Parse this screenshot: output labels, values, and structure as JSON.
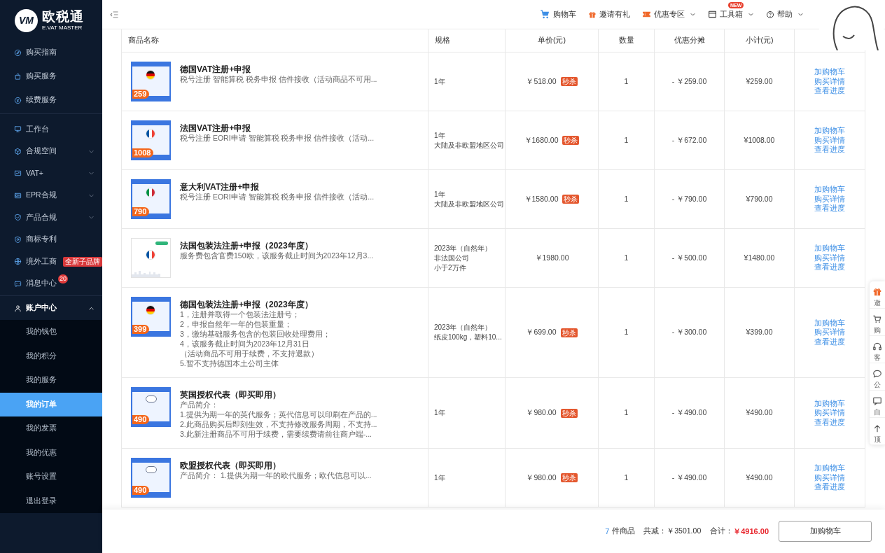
{
  "logo": {
    "mark": "VM",
    "name": "欧税通",
    "tagline": "E.VAT MASTER"
  },
  "sidebar": {
    "sections": [
      {
        "items": [
          {
            "label": "购买指南",
            "selected": false
          },
          {
            "label": "购买服务",
            "selected": false
          },
          {
            "label": "续费服务",
            "selected": false
          }
        ]
      },
      {
        "items": [
          {
            "label": "工作台",
            "selected": false
          },
          {
            "label": "合规空间",
            "selected": false,
            "expanded": false
          },
          {
            "label": "VAT+",
            "selected": false,
            "expanded": false
          },
          {
            "label": "EPR合规",
            "selected": false,
            "expanded": false
          },
          {
            "label": "产品合规",
            "selected": false,
            "expanded": false
          },
          {
            "label": "商标专利",
            "selected": false
          },
          {
            "label": "境外工商",
            "selected": false,
            "badge": "全新子品牌"
          },
          {
            "label": "消息中心",
            "selected": false,
            "count": "20"
          }
        ]
      },
      {
        "items": [
          {
            "label": "账户中心",
            "selected": false,
            "expanded": true,
            "children": [
              {
                "label": "我的钱包",
                "selected": false
              },
              {
                "label": "我的积分",
                "selected": false
              },
              {
                "label": "我的服务",
                "selected": false
              },
              {
                "label": "我的订单",
                "selected": true
              },
              {
                "label": "我的发票",
                "selected": false
              },
              {
                "label": "我的优惠",
                "selected": false
              },
              {
                "label": "账号设置",
                "selected": false
              },
              {
                "label": "退出登录",
                "selected": false
              }
            ]
          }
        ]
      }
    ]
  },
  "topbar": {
    "links": [
      {
        "label": "购物车",
        "dropdown": false
      },
      {
        "label": "邀请有礼",
        "dropdown": false
      },
      {
        "label": "优惠专区",
        "dropdown": true
      },
      {
        "label": "工具箱",
        "dropdown": true,
        "badge": "NEW"
      },
      {
        "label": "帮助",
        "dropdown": true
      }
    ]
  },
  "table": {
    "columns": [
      "商品名称",
      "规格",
      "单价(元)",
      "数量",
      "优惠分摊",
      "小计(元)"
    ],
    "rows": [
      {
        "image": {
          "kind": "germany",
          "price": "259"
        },
        "title": "德国VAT注册+申报",
        "description": [
          "税号注册 智能算税 税务申报 信件接收（活动商品不可用..."
        ],
        "spec": [
          "1年"
        ],
        "unit_price": "￥518.00",
        "flash_sale": "秒杀",
        "quantity": "1",
        "discount": "- ￥259.00",
        "subtotal": "¥259.00",
        "actions": [
          "加购物车",
          "购买详情",
          "查看进度"
        ]
      },
      {
        "image": {
          "kind": "france",
          "price": "1008"
        },
        "title": "法国VAT注册+申报",
        "description": [
          "税号注册 EORI申请 智能算税 税务申报 信件接收（活动..."
        ],
        "spec": [
          "1年",
          "大陆及非欧盟地区公司"
        ],
        "unit_price": "￥1680.00",
        "flash_sale": "秒杀",
        "quantity": "1",
        "discount": "- ￥672.00",
        "subtotal": "¥1008.00",
        "actions": [
          "加购物车",
          "购买详情",
          "查看进度"
        ]
      },
      {
        "image": {
          "kind": "italy",
          "price": "790"
        },
        "title": "意大利VAT注册+申报",
        "description": [
          "税号注册 EORI申请 智能算税 税务申报 信件接收（活动..."
        ],
        "spec": [
          "1年",
          "大陆及非欧盟地区公司"
        ],
        "unit_price": "￥1580.00",
        "flash_sale": "秒杀",
        "quantity": "1",
        "discount": "- ￥790.00",
        "subtotal": "¥790.00",
        "actions": [
          "加购物车",
          "购买详情",
          "查看进度"
        ]
      },
      {
        "image": {
          "kind": "packaging"
        },
        "title": "法国包装法注册+申报（2023年度）",
        "description": [
          "服务费包含官费150欧，该服务截止时间为2023年12月3..."
        ],
        "spec": [
          "2023年（自然年）",
          "非法国公司",
          "小于2万件"
        ],
        "unit_price": "￥1980.00",
        "quantity": "1",
        "discount": "- ￥500.00",
        "subtotal": "¥1480.00",
        "actions": [
          "加购物车",
          "购买详情",
          "查看进度"
        ]
      },
      {
        "image": {
          "kind": "germany",
          "price": "399"
        },
        "title": "德国包装法注册+申报（2023年度）",
        "description": [
          "1，注册并取得一个包装法注册号；",
          "2，申报自然年一年的包装重量；",
          "3，缴纳基础服务包含的包装回收处理费用；",
          "4，该服务截止时间为2023年12月31日",
          "（活动商品不可用于续费，不支持退款）",
          "5.暂不支持德国本土公司主体"
        ],
        "spec": [
          "2023年（自然年）",
          "纸皮100kg，塑料10..."
        ],
        "unit_price": "￥699.00",
        "flash_sale": "秒杀",
        "quantity": "1",
        "discount": "- ￥300.00",
        "subtotal": "¥399.00",
        "actions": [
          "加购物车",
          "购买详情",
          "查看进度"
        ]
      },
      {
        "image": {
          "kind": "representative",
          "price": "490"
        },
        "title": "英国授权代表（即买即用）",
        "description": [
          "产品简介：",
          "1.提供为期一年的英代服务；英代信息可以印刷在产品的...",
          "2.此商品购买后即刻生效，不支持修改服务周期，不支持...",
          "3.此新注册商品不可用于续费，需要续费请前往商户端-..."
        ],
        "spec": [
          "1年"
        ],
        "unit_price": "￥980.00",
        "flash_sale": "秒杀",
        "quantity": "1",
        "discount": "- ￥490.00",
        "subtotal": "¥490.00",
        "actions": [
          "加购物车",
          "购买详情",
          "查看进度"
        ]
      },
      {
        "image": {
          "kind": "representative",
          "price": "490"
        },
        "title": "欧盟授权代表（即买即用）",
        "description": [
          "产品简介： 1.提供为期一年的欧代服务；欧代信息可以..."
        ],
        "spec": [
          "1年"
        ],
        "unit_price": "￥980.00",
        "flash_sale": "秒杀",
        "quantity": "1",
        "discount": "- ￥490.00",
        "subtotal": "¥490.00",
        "actions": [
          "加购物车",
          "购买详情",
          "查看进度"
        ]
      }
    ]
  },
  "footer": {
    "count": "7",
    "count_label": "件商品",
    "discount_label": "共减：",
    "discount": "￥3501.00",
    "total_label": "合计：",
    "total": "￥4916.00",
    "button": "加购物车"
  },
  "side_widget": {
    "items": [
      {
        "label": "邀"
      },
      {
        "label": "购"
      },
      {
        "label": "客"
      },
      {
        "label": "公"
      },
      {
        "label": "自"
      },
      {
        "label": "顶"
      }
    ]
  }
}
